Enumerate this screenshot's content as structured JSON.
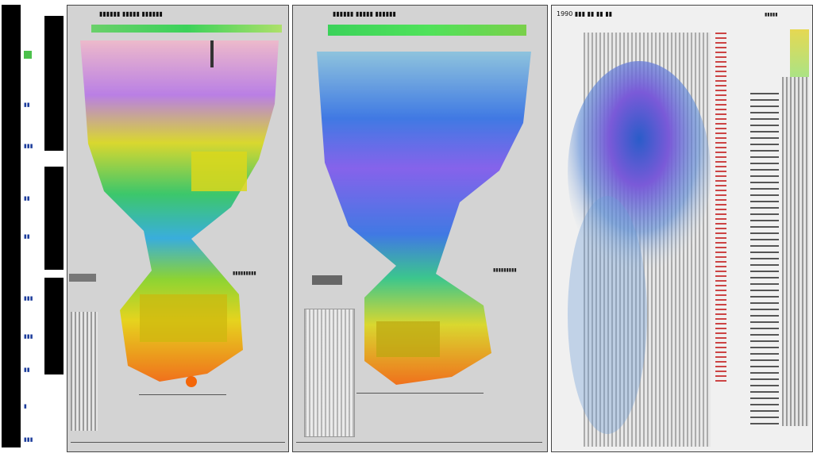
{
  "window": {
    "panels": [
      {
        "title": "▮▮▮▮▮▮  ▮▮▮▮▮  ▮▮▮▮▮▮",
        "status": "▮▮▮▮▮▮▮▮▮"
      },
      {
        "title": "▮▮▮▮▮▮  ▮▮▮▮▮  ▮▮▮▮▮▮",
        "status": "▮▮▮▮▮▮▮▮▮"
      },
      {
        "title": "1990  ▮▮▮  ▮▮  ▮▮  ▮▮",
        "status": "▮▮▮▮▮"
      }
    ]
  },
  "sidebar": {
    "labels": [
      "▮▮",
      "▮▮▮",
      "▮▮",
      "▮▮",
      "▮▮▮",
      "▮▮▮",
      "▮▮",
      "▮",
      "▮▮▮"
    ]
  },
  "colors": {
    "panel_bg": "#d3d3d3",
    "accent_blue": "#3a6fd1",
    "accent_green": "#3bd25a",
    "accent_yellow": "#d8d63a",
    "accent_purple": "#b07ad8",
    "accent_orange": "#e06a1c"
  },
  "icons": [
    "sidebar-block-icon",
    "heatmap-icon",
    "vertical-bars-icon"
  ]
}
